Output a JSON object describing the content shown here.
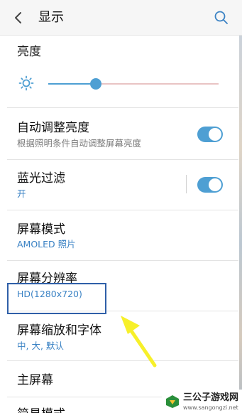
{
  "header": {
    "title": "显示",
    "back_icon": "chevron-left-icon",
    "search_icon": "search-icon"
  },
  "brightness": {
    "title": "亮度",
    "icon": "sun-icon",
    "level": 0.28
  },
  "settings": [
    {
      "title": "自动调整亮度",
      "subtitle": "根据照明条件自动调整屏幕亮度",
      "subtitle_style": "gray",
      "toggle": true,
      "enabled": true
    },
    {
      "title": "蓝光过滤",
      "subtitle": "开",
      "subtitle_style": "blue",
      "toggle": true,
      "enabled": true
    },
    {
      "title": "屏幕模式",
      "subtitle": "AMOLED 照片",
      "subtitle_style": "blue"
    },
    {
      "title": "屏幕分辨率",
      "subtitle": "HD(1280x720)",
      "subtitle_style": "blue"
    },
    {
      "title": "屏幕缩放和字体",
      "subtitle": "中, 大, 默认",
      "subtitle_style": "blue"
    },
    {
      "title": "主屏幕"
    },
    {
      "title": "简易模式"
    }
  ],
  "annotation": {
    "box_color": "#2f5fa8",
    "arrow_color": "#f7f02a"
  },
  "watermark": {
    "name": "三公子游戏网",
    "url": "www.sangongzi.net"
  },
  "colors": {
    "accent": "#4e9fd3",
    "subtitle_blue": "#3a82c4"
  }
}
